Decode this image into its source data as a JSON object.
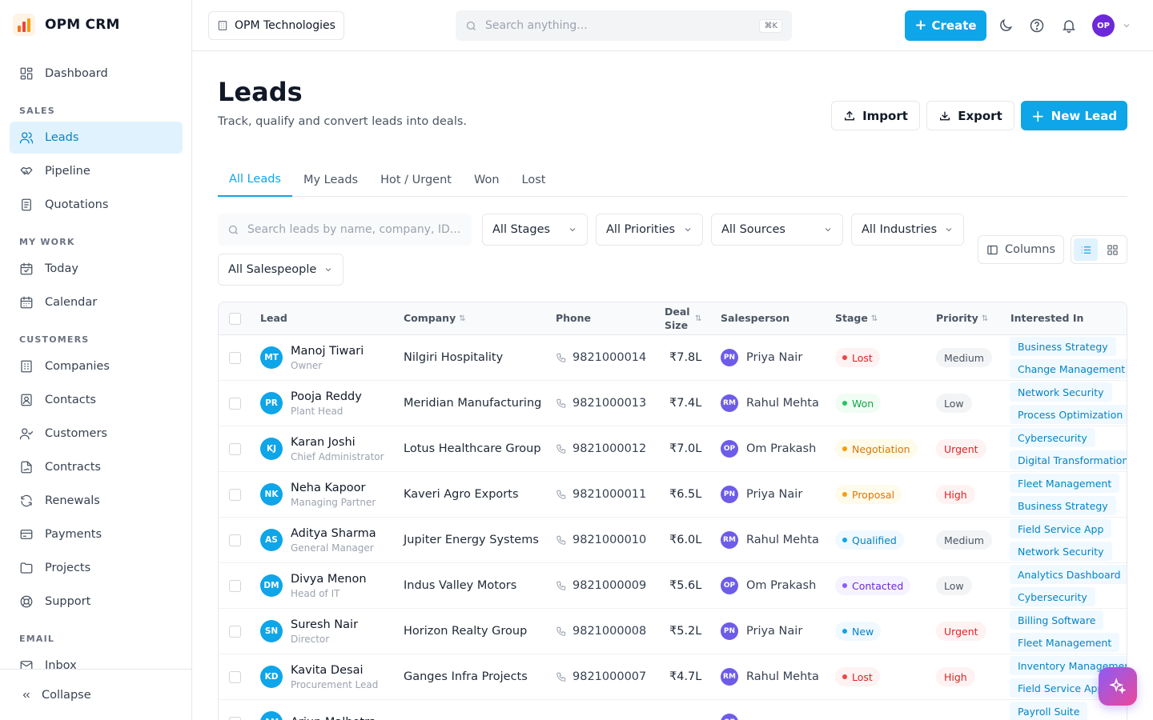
{
  "brand": {
    "name": "OPM CRM"
  },
  "sidebar": {
    "items_top": [
      {
        "label": "Dashboard",
        "icon": "grid-icon"
      }
    ],
    "sections": [
      {
        "title": "SALES",
        "items": [
          {
            "label": "Leads",
            "icon": "users-icon",
            "active": true
          },
          {
            "label": "Pipeline",
            "icon": "handshake-icon"
          },
          {
            "label": "Quotations",
            "icon": "document-icon"
          }
        ]
      },
      {
        "title": "MY WORK",
        "items": [
          {
            "label": "Today",
            "icon": "calendar-check-icon"
          },
          {
            "label": "Calendar",
            "icon": "calendar-icon"
          }
        ]
      },
      {
        "title": "CUSTOMERS",
        "items": [
          {
            "label": "Companies",
            "icon": "building-icon"
          },
          {
            "label": "Contacts",
            "icon": "contact-card-icon"
          },
          {
            "label": "Customers",
            "icon": "user-check-icon"
          },
          {
            "label": "Contracts",
            "icon": "file-signature-icon"
          },
          {
            "label": "Renewals",
            "icon": "refresh-icon"
          },
          {
            "label": "Payments",
            "icon": "credit-card-icon"
          },
          {
            "label": "Projects",
            "icon": "folder-icon"
          },
          {
            "label": "Support",
            "icon": "lifebuoy-icon"
          }
        ]
      },
      {
        "title": "EMAIL",
        "items": [
          {
            "label": "Inbox",
            "icon": "inbox-icon"
          }
        ]
      }
    ],
    "collapse_label": "Collapse"
  },
  "topbar": {
    "org_name": "OPM Technologies",
    "search_placeholder": "Search anything...",
    "search_shortcut": "⌘K",
    "create_label": "Create",
    "user_initials": "OP"
  },
  "page": {
    "title": "Leads",
    "subtitle": "Track, qualify and convert leads into deals.",
    "import_label": "Import",
    "export_label": "Export",
    "new_lead_label": "New Lead"
  },
  "tabs": [
    "All Leads",
    "My Leads",
    "Hot / Urgent",
    "Won",
    "Lost"
  ],
  "filters": {
    "search_placeholder": "Search leads by name, company, ID...",
    "stages": "All Stages",
    "priorities": "All Priorities",
    "sources": "All Sources",
    "industries": "All Industries",
    "salespeople": "All Salespeople",
    "columns_label": "Columns"
  },
  "table": {
    "headers": {
      "lead": "Lead",
      "company": "Company",
      "phone": "Phone",
      "deal_size": "Deal Size",
      "salesperson": "Salesperson",
      "stage": "Stage",
      "priority": "Priority",
      "interested_in": "Interested In"
    },
    "rows": [
      {
        "initials": "MT",
        "name": "Manoj Tiwari",
        "role": "Owner",
        "company": "Nilgiri Hospitality",
        "phone": "9821000014",
        "deal": "₹7.8L",
        "sp_initials": "PN",
        "salesperson": "Priya Nair",
        "stage": "Lost",
        "priority": "Medium",
        "interests": [
          "Business Strategy",
          "Change Management"
        ]
      },
      {
        "initials": "PR",
        "name": "Pooja Reddy",
        "role": "Plant Head",
        "company": "Meridian Manufacturing",
        "phone": "9821000013",
        "deal": "₹7.4L",
        "sp_initials": "RM",
        "salesperson": "Rahul Mehta",
        "stage": "Won",
        "priority": "Low",
        "interests": [
          "Network Security",
          "Process Optimization"
        ]
      },
      {
        "initials": "KJ",
        "name": "Karan Joshi",
        "role": "Chief Administrator",
        "company": "Lotus Healthcare Group",
        "phone": "9821000012",
        "deal": "₹7.0L",
        "sp_initials": "OP",
        "salesperson": "Om Prakash",
        "stage": "Negotiation",
        "priority": "Urgent",
        "interests": [
          "Cybersecurity",
          "Digital Transformation"
        ]
      },
      {
        "initials": "NK",
        "name": "Neha Kapoor",
        "role": "Managing Partner",
        "company": "Kaveri Agro Exports",
        "phone": "9821000011",
        "deal": "₹6.5L",
        "sp_initials": "PN",
        "salesperson": "Priya Nair",
        "stage": "Proposal",
        "priority": "High",
        "interests": [
          "Fleet Management",
          "Business Strategy"
        ]
      },
      {
        "initials": "AS",
        "name": "Aditya Sharma",
        "role": "General Manager",
        "company": "Jupiter Energy Systems",
        "phone": "9821000010",
        "deal": "₹6.0L",
        "sp_initials": "RM",
        "salesperson": "Rahul Mehta",
        "stage": "Qualified",
        "priority": "Medium",
        "interests": [
          "Field Service App",
          "Network Security"
        ]
      },
      {
        "initials": "DM",
        "name": "Divya Menon",
        "role": "Head of IT",
        "company": "Indus Valley Motors",
        "phone": "9821000009",
        "deal": "₹5.6L",
        "sp_initials": "OP",
        "salesperson": "Om Prakash",
        "stage": "Contacted",
        "priority": "Low",
        "interests": [
          "Analytics Dashboard",
          "Cybersecurity"
        ]
      },
      {
        "initials": "SN",
        "name": "Suresh Nair",
        "role": "Director",
        "company": "Horizon Realty Group",
        "phone": "9821000008",
        "deal": "₹5.2L",
        "sp_initials": "PN",
        "salesperson": "Priya Nair",
        "stage": "New",
        "priority": "Urgent",
        "interests": [
          "Billing Software",
          "Fleet Management"
        ]
      },
      {
        "initials": "KD",
        "name": "Kavita Desai",
        "role": "Procurement Lead",
        "company": "Ganges Infra Projects",
        "phone": "9821000007",
        "deal": "₹4.7L",
        "sp_initials": "RM",
        "salesperson": "Rahul Mehta",
        "stage": "Lost",
        "priority": "High",
        "interests": [
          "Inventory Management",
          "Field Service App"
        ]
      },
      {
        "initials": "AM",
        "name": "Arjun Malhotra",
        "role": "",
        "company": "",
        "phone": "",
        "deal": "",
        "sp_initials": "OP",
        "salesperson": "",
        "stage": "",
        "priority": "",
        "interests": [
          "Payroll Suite"
        ]
      }
    ]
  },
  "colors": {
    "accent": "#0ea5e9",
    "stage": {
      "Lost": {
        "bg": "#fef2f2",
        "fg": "#dc2626",
        "dot": "#ef4444"
      },
      "Won": {
        "bg": "#f0fdf4",
        "fg": "#16a34a",
        "dot": "#22c55e"
      },
      "Negotiation": {
        "bg": "#fffbeb",
        "fg": "#d97706",
        "dot": "#f59e0b"
      },
      "Proposal": {
        "bg": "#fffbeb",
        "fg": "#d97706",
        "dot": "#f59e0b"
      },
      "Qualified": {
        "bg": "#f0f9ff",
        "fg": "#0284c7",
        "dot": "#0ea5e9"
      },
      "Contacted": {
        "bg": "#f5f3ff",
        "fg": "#6d28d9",
        "dot": "#8b5cf6"
      },
      "New": {
        "bg": "#f0f9ff",
        "fg": "#0284c7",
        "dot": "#0ea5e9"
      }
    },
    "priority": {
      "Medium": {
        "bg": "#f3f4f6",
        "fg": "#4b5563"
      },
      "Low": {
        "bg": "#f3f4f6",
        "fg": "#4b5563"
      },
      "Urgent": {
        "bg": "#fef2f2",
        "fg": "#dc2626"
      },
      "High": {
        "bg": "#fef2f2",
        "fg": "#dc2626"
      }
    }
  }
}
